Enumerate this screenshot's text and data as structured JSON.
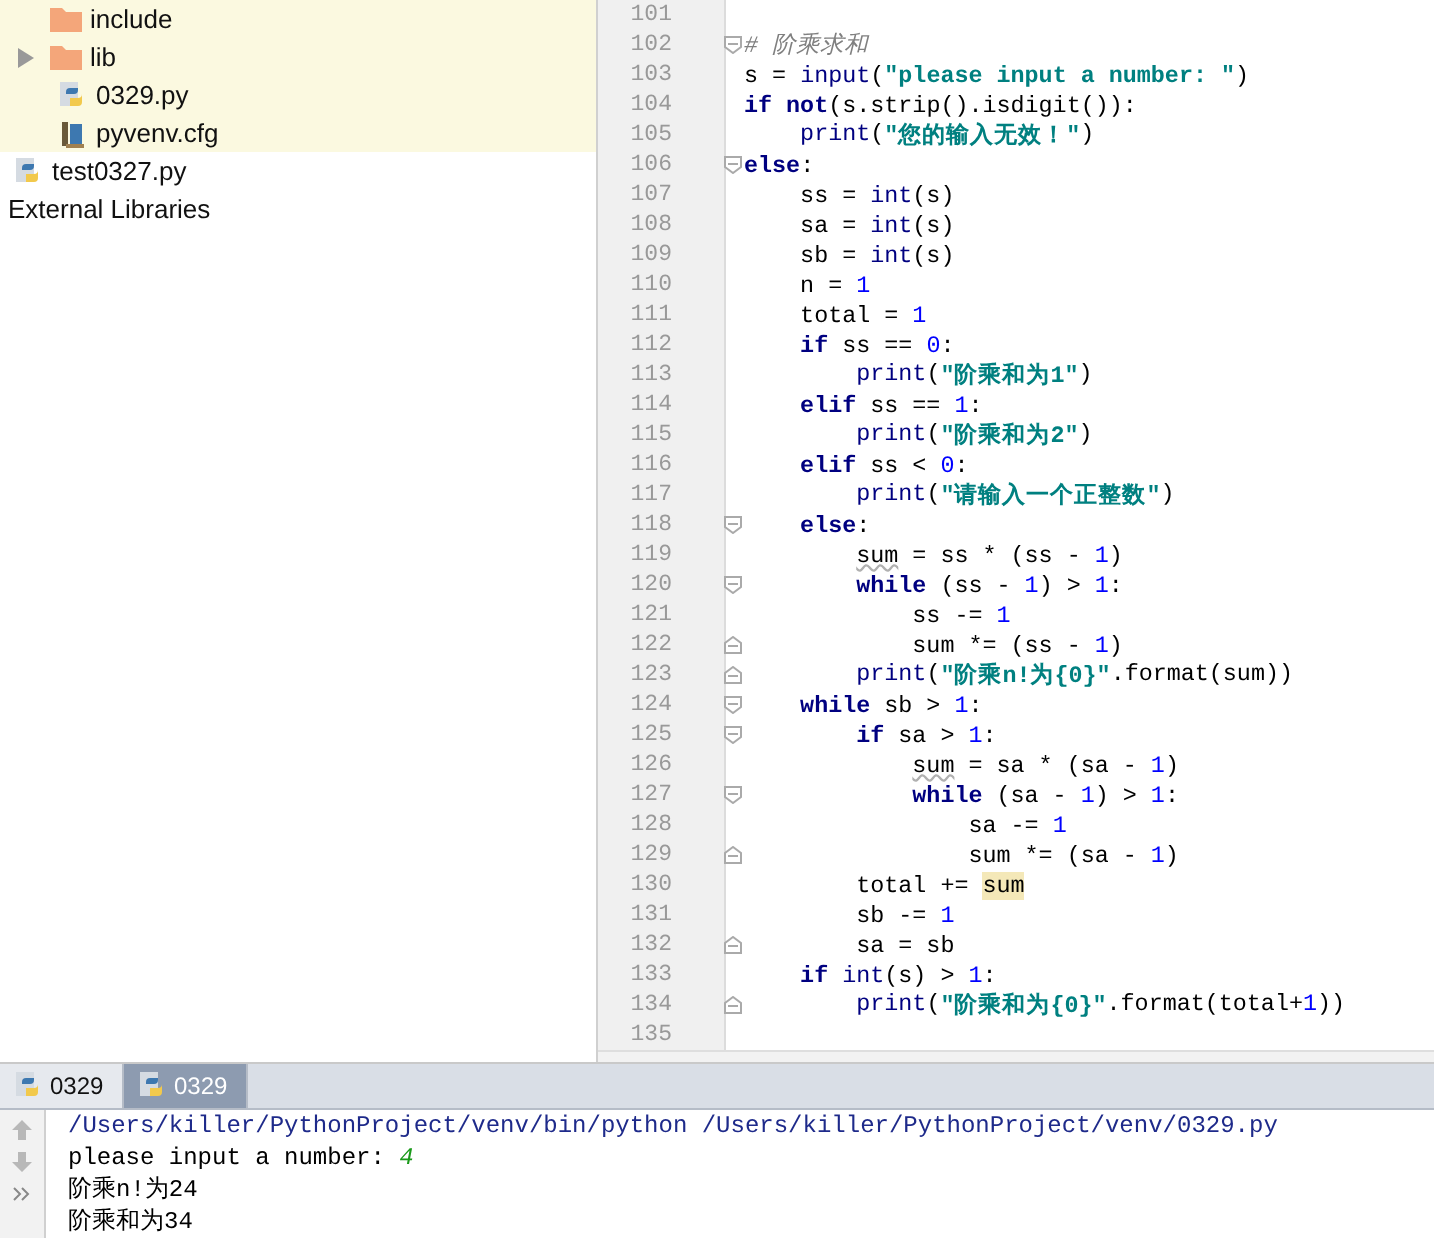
{
  "sidebar": {
    "folder_contents": [
      {
        "label": "include",
        "kind": "folder"
      },
      {
        "label": "lib",
        "kind": "folder",
        "expanded": false
      },
      {
        "label": "0329.py",
        "kind": "python"
      },
      {
        "label": "pyvenv.cfg",
        "kind": "config"
      }
    ],
    "items": [
      {
        "label": "test0327.py",
        "kind": "python"
      },
      {
        "label": "External Libraries",
        "kind": "library"
      }
    ]
  },
  "editor": {
    "lines": [
      {
        "line_no": "101"
      },
      {
        "line_no": "102",
        "fold_start": true,
        "tokens": [
          {
            "kind": "comment",
            "text": "# 阶乘求和"
          }
        ]
      },
      {
        "line_no": "103",
        "tokens": [
          {
            "kind": "plain",
            "text": "s = "
          },
          {
            "kind": "builtin",
            "text": "input"
          },
          {
            "kind": "plain",
            "text": "("
          },
          {
            "kind": "string",
            "text": "\"please input a number: \""
          },
          {
            "kind": "plain",
            "text": ")"
          }
        ]
      },
      {
        "line_no": "104",
        "tokens": [
          {
            "kind": "keyword",
            "text": "if not"
          },
          {
            "kind": "plain",
            "text": "(s.strip().isdigit()):"
          }
        ]
      },
      {
        "line_no": "105",
        "tokens": [
          {
            "kind": "builtin",
            "text": "    print"
          },
          {
            "kind": "plain",
            "text": "("
          },
          {
            "kind": "string",
            "text": "\"您的输入无效！\""
          },
          {
            "kind": "plain",
            "text": ")"
          }
        ]
      },
      {
        "line_no": "106",
        "fold_start": true,
        "tokens": [
          {
            "kind": "keyword",
            "text": "else"
          },
          {
            "kind": "plain",
            "text": ":"
          }
        ]
      },
      {
        "line_no": "107",
        "tokens": [
          {
            "kind": "plain",
            "text": "    ss = "
          },
          {
            "kind": "builtin",
            "text": "int"
          },
          {
            "kind": "plain",
            "text": "(s)"
          }
        ]
      },
      {
        "line_no": "108",
        "tokens": [
          {
            "kind": "plain",
            "text": "    sa = "
          },
          {
            "kind": "builtin",
            "text": "int"
          },
          {
            "kind": "plain",
            "text": "(s)"
          }
        ]
      },
      {
        "line_no": "109",
        "tokens": [
          {
            "kind": "plain",
            "text": "    sb = "
          },
          {
            "kind": "builtin",
            "text": "int"
          },
          {
            "kind": "plain",
            "text": "(s)"
          }
        ]
      },
      {
        "line_no": "110",
        "tokens": [
          {
            "kind": "plain",
            "text": "    n = "
          },
          {
            "kind": "numeral",
            "text": "1"
          }
        ]
      },
      {
        "line_no": "111",
        "tokens": [
          {
            "kind": "plain",
            "text": "    total = "
          },
          {
            "kind": "numeral",
            "text": "1"
          }
        ]
      },
      {
        "line_no": "112",
        "tokens": [
          {
            "kind": "keyword",
            "text": "    if"
          },
          {
            "kind": "plain",
            "text": " ss == "
          },
          {
            "kind": "numeral",
            "text": "0"
          },
          {
            "kind": "plain",
            "text": ":"
          }
        ]
      },
      {
        "line_no": "113",
        "tokens": [
          {
            "kind": "builtin",
            "text": "        print"
          },
          {
            "kind": "plain",
            "text": "("
          },
          {
            "kind": "string",
            "text": "\"阶乘和为1\""
          },
          {
            "kind": "plain",
            "text": ")"
          }
        ]
      },
      {
        "line_no": "114",
        "tokens": [
          {
            "kind": "keyword",
            "text": "    elif"
          },
          {
            "kind": "plain",
            "text": " ss == "
          },
          {
            "kind": "numeral",
            "text": "1"
          },
          {
            "kind": "plain",
            "text": ":"
          }
        ]
      },
      {
        "line_no": "115",
        "tokens": [
          {
            "kind": "builtin",
            "text": "        print"
          },
          {
            "kind": "plain",
            "text": "("
          },
          {
            "kind": "string",
            "text": "\"阶乘和为2\""
          },
          {
            "kind": "plain",
            "text": ")"
          }
        ]
      },
      {
        "line_no": "116",
        "tokens": [
          {
            "kind": "keyword",
            "text": "    elif"
          },
          {
            "kind": "plain",
            "text": " ss < "
          },
          {
            "kind": "numeral",
            "text": "0"
          },
          {
            "kind": "plain",
            "text": ":"
          }
        ]
      },
      {
        "line_no": "117",
        "tokens": [
          {
            "kind": "builtin",
            "text": "        print"
          },
          {
            "kind": "plain",
            "text": "("
          },
          {
            "kind": "string",
            "text": "\"请输入一个正整数\""
          },
          {
            "kind": "plain",
            "text": ")"
          }
        ]
      },
      {
        "line_no": "118",
        "fold_start": true,
        "tokens": [
          {
            "kind": "keyword",
            "text": "    else"
          },
          {
            "kind": "plain",
            "text": ":"
          }
        ]
      },
      {
        "line_no": "119",
        "tokens": [
          {
            "kind": "warning",
            "text": "        sum"
          },
          {
            "kind": "plain",
            "text": " = ss * (ss - "
          },
          {
            "kind": "numeral",
            "text": "1"
          },
          {
            "kind": "plain",
            "text": ")"
          }
        ]
      },
      {
        "line_no": "120",
        "fold_start": true,
        "tokens": [
          {
            "kind": "keyword",
            "text": "        while"
          },
          {
            "kind": "plain",
            "text": " (ss - "
          },
          {
            "kind": "numeral",
            "text": "1"
          },
          {
            "kind": "plain",
            "text": ") > "
          },
          {
            "kind": "numeral",
            "text": "1"
          },
          {
            "kind": "plain",
            "text": ":"
          }
        ]
      },
      {
        "line_no": "121",
        "tokens": [
          {
            "kind": "plain",
            "text": "            ss -= "
          },
          {
            "kind": "numeral",
            "text": "1"
          }
        ]
      },
      {
        "line_no": "122",
        "fold_end": true,
        "tokens": [
          {
            "kind": "plain",
            "text": "            sum *= (ss - "
          },
          {
            "kind": "numeral",
            "text": "1"
          },
          {
            "kind": "plain",
            "text": ")"
          }
        ]
      },
      {
        "line_no": "123",
        "fold_end": true,
        "tokens": [
          {
            "kind": "builtin",
            "text": "        print"
          },
          {
            "kind": "plain",
            "text": "("
          },
          {
            "kind": "string",
            "text": "\"阶乘n!为{0}\""
          },
          {
            "kind": "plain",
            "text": ".format(sum))"
          }
        ]
      },
      {
        "line_no": "124",
        "fold_start": true,
        "tokens": [
          {
            "kind": "keyword",
            "text": "    while"
          },
          {
            "kind": "plain",
            "text": " sb > "
          },
          {
            "kind": "numeral",
            "text": "1"
          },
          {
            "kind": "plain",
            "text": ":"
          }
        ]
      },
      {
        "line_no": "125",
        "fold_start": true,
        "tokens": [
          {
            "kind": "keyword",
            "text": "        if"
          },
          {
            "kind": "plain",
            "text": " sa > "
          },
          {
            "kind": "numeral",
            "text": "1"
          },
          {
            "kind": "plain",
            "text": ":"
          }
        ]
      },
      {
        "line_no": "126",
        "tokens": [
          {
            "kind": "warning",
            "text": "            sum"
          },
          {
            "kind": "plain",
            "text": " = sa * (sa - "
          },
          {
            "kind": "numeral",
            "text": "1"
          },
          {
            "kind": "plain",
            "text": ")"
          }
        ]
      },
      {
        "line_no": "127",
        "fold_start": true,
        "tokens": [
          {
            "kind": "keyword",
            "text": "            while"
          },
          {
            "kind": "plain",
            "text": " (sa - "
          },
          {
            "kind": "numeral",
            "text": "1"
          },
          {
            "kind": "plain",
            "text": ") > "
          },
          {
            "kind": "numeral",
            "text": "1"
          },
          {
            "kind": "plain",
            "text": ":"
          }
        ]
      },
      {
        "line_no": "128",
        "tokens": [
          {
            "kind": "plain",
            "text": "                sa -= "
          },
          {
            "kind": "numeral",
            "text": "1"
          }
        ]
      },
      {
        "line_no": "129",
        "fold_end": true,
        "tokens": [
          {
            "kind": "plain",
            "text": "                sum *= (sa - "
          },
          {
            "kind": "numeral",
            "text": "1"
          },
          {
            "kind": "plain",
            "text": ")"
          }
        ]
      },
      {
        "line_no": "130",
        "tokens": [
          {
            "kind": "plain",
            "text": "        total += "
          },
          {
            "kind": "usage",
            "text": "sum"
          }
        ]
      },
      {
        "line_no": "131",
        "tokens": [
          {
            "kind": "plain",
            "text": "        sb -= "
          },
          {
            "kind": "numeral",
            "text": "1"
          }
        ]
      },
      {
        "line_no": "132",
        "fold_end": true,
        "tokens": [
          {
            "kind": "plain",
            "text": "        sa = sb"
          }
        ]
      },
      {
        "line_no": "133",
        "tokens": [
          {
            "kind": "keyword",
            "text": "    if"
          },
          {
            "kind": "builtin",
            "text": " int"
          },
          {
            "kind": "plain",
            "text": "(s) > "
          },
          {
            "kind": "numeral",
            "text": "1"
          },
          {
            "kind": "plain",
            "text": ":"
          }
        ]
      },
      {
        "line_no": "134",
        "fold_end": true,
        "tokens": [
          {
            "kind": "builtin",
            "text": "        print"
          },
          {
            "kind": "plain",
            "text": "("
          },
          {
            "kind": "string",
            "text": "\"阶乘和为{0}\""
          },
          {
            "kind": "plain",
            "text": ".format(total+"
          },
          {
            "kind": "numeral",
            "text": "1"
          },
          {
            "kind": "plain",
            "text": "))"
          }
        ]
      },
      {
        "line_no": "135"
      }
    ]
  },
  "run_panel": {
    "tabs": [
      {
        "label": "0329",
        "selected": false
      },
      {
        "label": "0329",
        "selected": true
      }
    ],
    "console": [
      {
        "kind": "command",
        "text": "/Users/killer/PythonProject/venv/bin/python /Users/killer/PythonProject/venv/0329.py"
      },
      {
        "kind": "prompt",
        "text": "please input a number: ",
        "input": "4"
      },
      {
        "kind": "output",
        "text": "阶乘n!为24"
      },
      {
        "kind": "output",
        "text": "阶乘和为34"
      }
    ]
  }
}
